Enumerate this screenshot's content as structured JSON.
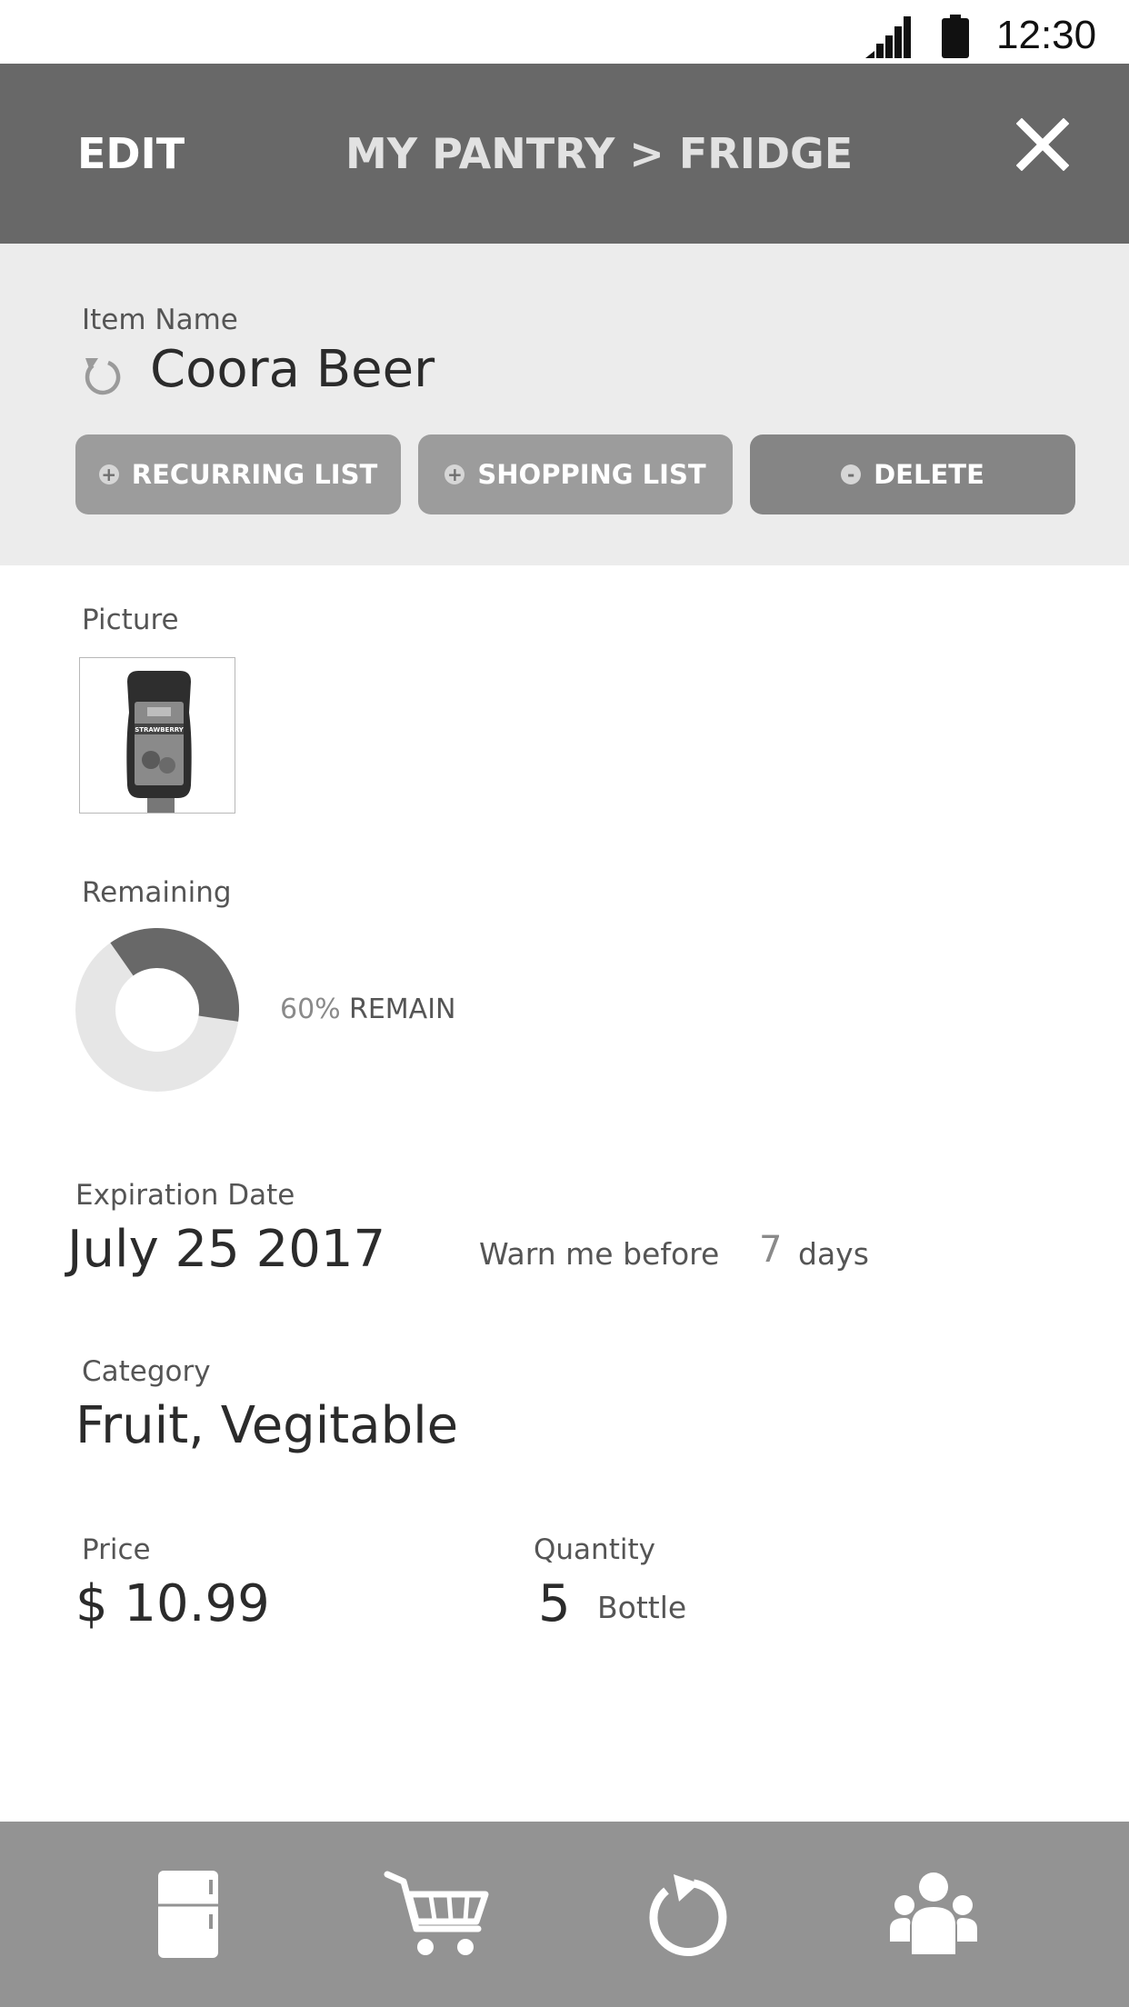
{
  "status_bar": {
    "time": "12:30",
    "icons": [
      "signal-icon",
      "battery-icon"
    ]
  },
  "header": {
    "edit_label": "EDIT",
    "title": "MY PANTRY > FRIDGE",
    "close_icon": "close-icon"
  },
  "item": {
    "name_label": "Item Name",
    "name_value": "Coora Beer",
    "reset_icon": "reset-icon"
  },
  "actions": {
    "recurring": {
      "symbol": "+",
      "label": "RECURRING LIST"
    },
    "shopping": {
      "symbol": "+",
      "label": "SHOPPING LIST"
    },
    "delete": {
      "symbol": "-",
      "label": "DELETE"
    }
  },
  "picture": {
    "label": "Picture",
    "bottle_label": "STRAWBERRY"
  },
  "remaining": {
    "label": "Remaining",
    "percent_text": "60%",
    "fraction": 0.6,
    "suffix": "REMAIN"
  },
  "expiration": {
    "label": "Expiration Date",
    "value": "July 25 2017",
    "warn_label": "Warn me before",
    "warn_days": "7",
    "warn_unit": "days"
  },
  "category": {
    "label": "Category",
    "value": "Fruit, Vegitable"
  },
  "price": {
    "label": "Price",
    "value": "$ 10.99"
  },
  "quantity": {
    "label": "Quantity",
    "value": "5",
    "unit": "Bottle"
  },
  "bottom_nav": {
    "items": [
      "fridge-icon",
      "cart-icon",
      "recurring-icon",
      "family-icon"
    ]
  },
  "colors": {
    "header_bg": "#686868",
    "section_bg": "#ececec",
    "button_bg": "#9c9c9c",
    "delete_bg": "#858585",
    "nav_bg": "#939393",
    "donut_filled": "#686868",
    "donut_empty": "#e6e6e6"
  }
}
